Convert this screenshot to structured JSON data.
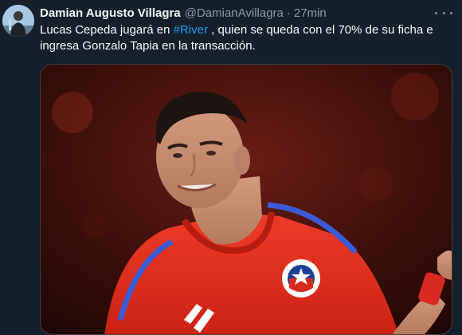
{
  "tweet": {
    "author": {
      "display_name": "Damian Augusto Villagra",
      "handle": "@DamianAvillagra",
      "separator": "·",
      "time": "27min"
    },
    "text": {
      "line1_prefix": "Lucas Cepeda jugará en ",
      "hashtag": "#River",
      "line1_suffix": " , quien se queda con el 70% de su ficha e",
      "line2": "ingresa Gonzalo Tapia en la transacción."
    },
    "more_icon": "more-horizontal-icon",
    "media": {
      "jersey_color": "#e3301f",
      "accent_color": "#1d9bf0"
    }
  }
}
